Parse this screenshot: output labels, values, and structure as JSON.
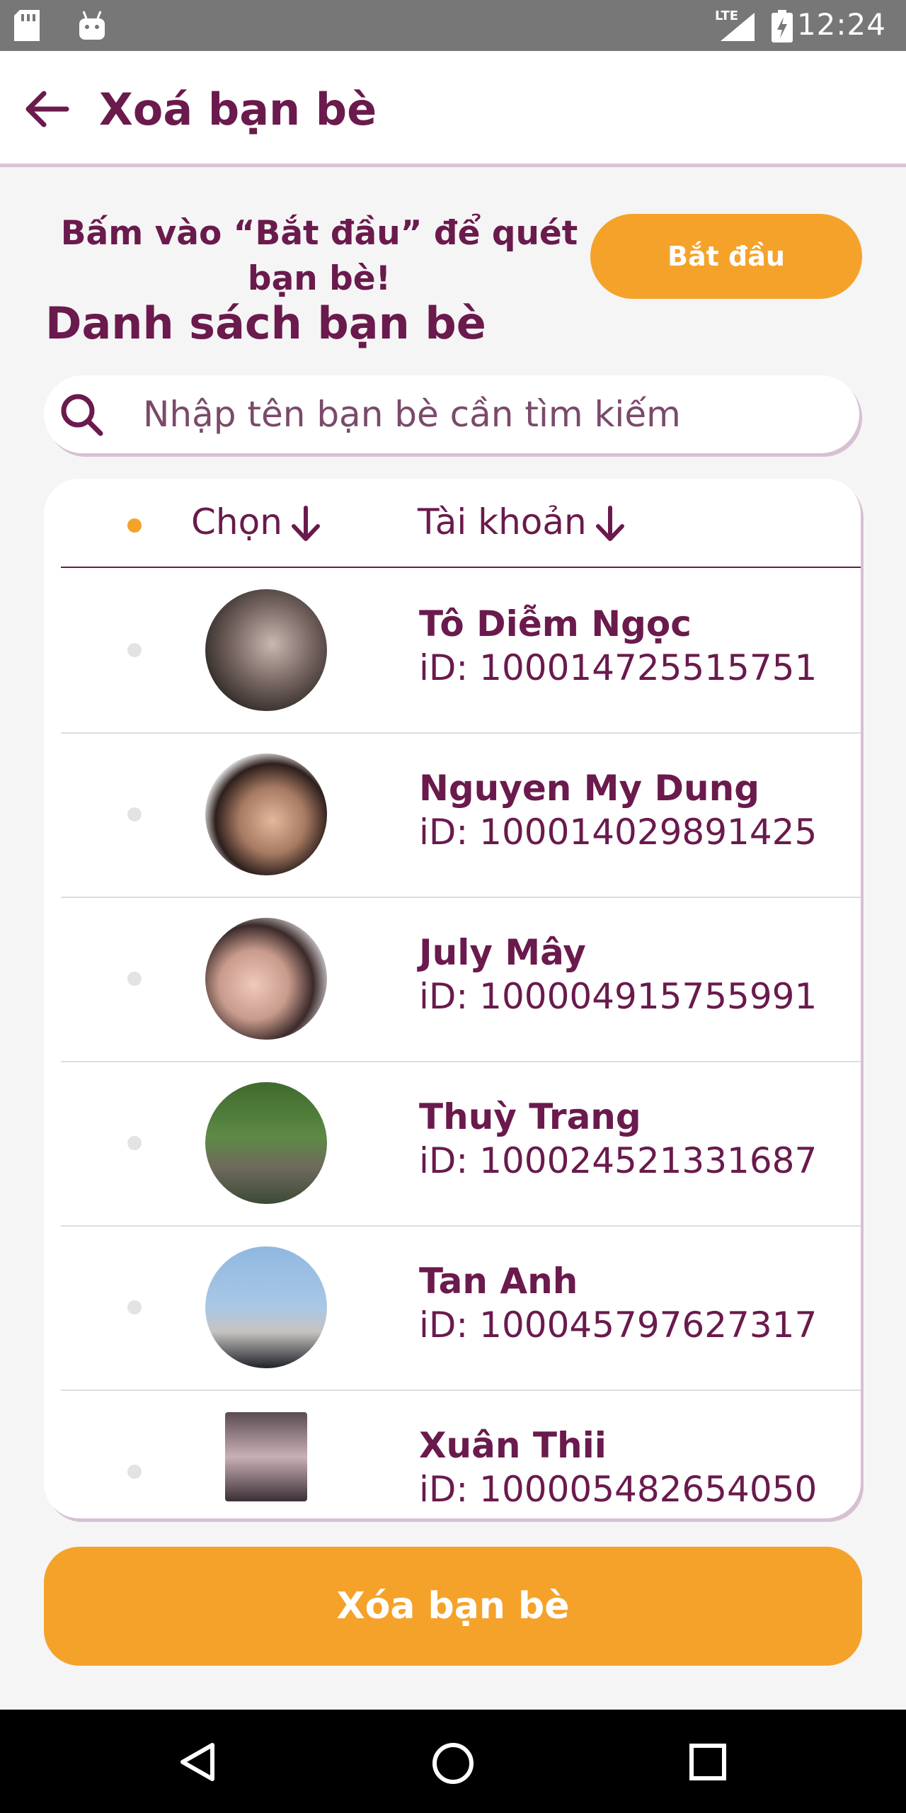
{
  "status_bar": {
    "network": "LTE",
    "time": "12:24"
  },
  "app_bar": {
    "title": "Xoá bạn bè"
  },
  "scan": {
    "hint": "Bấm vào “Bắt đầu” để quét bạn bè!",
    "start_label": "Bắt đầu"
  },
  "list_heading": "Danh sách bạn bè",
  "search": {
    "placeholder": "Nhập tên bạn bè cần tìm kiếm",
    "value": ""
  },
  "table_header": {
    "choose": "Chọn",
    "account": "Tài khoản"
  },
  "friends": [
    {
      "name": "Tô Diễm Ngọc",
      "id": "iD: 100014725515751"
    },
    {
      "name": "Nguyen My Dung",
      "id": "iD: 100014029891425"
    },
    {
      "name": "July Mây",
      "id": "iD: 100004915755991"
    },
    {
      "name": "Thuỳ Trang",
      "id": "iD: 100024521331687"
    },
    {
      "name": "Tan Anh",
      "id": "iD: 100045797627317"
    },
    {
      "name": "Xuân Thii",
      "id": "iD: 100005482654050"
    }
  ],
  "delete_label": "Xóa bạn bè",
  "colors": {
    "primary": "#6a1a4c",
    "accent": "#f5a22b",
    "status_bar": "#777777"
  },
  "icons": {
    "back": "arrow-left-icon",
    "search": "search-icon",
    "sort": "arrow-down-icon",
    "nav_back": "triangle-back-icon",
    "nav_home": "circle-home-icon",
    "nav_recents": "square-recents-icon"
  }
}
